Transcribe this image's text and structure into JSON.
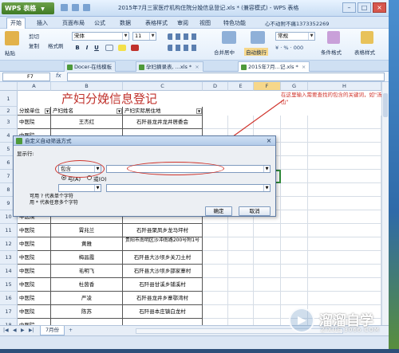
{
  "app": {
    "name": "WPS 表格",
    "title": "2015年7月三家医疗机构住院分娩信息登记.xls * (兼容模式) - WPS 表格"
  },
  "menu": {
    "tabs": [
      "开始",
      "插入",
      "页面布局",
      "公式",
      "数据",
      "表格样式",
      "审阅",
      "视图",
      "特色功能"
    ],
    "active": "开始",
    "notify": "心不动附不痛1373352269"
  },
  "ribbon": {
    "paste": "粘贴",
    "cut": "剪切",
    "copy": "复制",
    "format_painter": "格式刷",
    "font_name": "宋体",
    "font_size": "11",
    "bold": "B",
    "italic": "I",
    "underline": "U",
    "merge": "合并居中",
    "wrap": "自动换行",
    "general": "常规",
    "conditional": "条件格式",
    "table_style": "表格样式"
  },
  "doc_tabs": [
    {
      "label": "Docer-在线模板",
      "active": false
    },
    {
      "label": "孕妇摘录表, ...xls *",
      "active": false
    },
    {
      "label": "2015年7月...记.xls *",
      "active": true
    }
  ],
  "formula": {
    "cell_ref": "F7",
    "fx": "fx",
    "value": ""
  },
  "columns": [
    "A",
    "B",
    "C",
    "D",
    "E",
    "F",
    "G",
    "H"
  ],
  "selected_column": "F",
  "sheet": {
    "title": "产妇分娩信息登记",
    "headers": [
      "分娩单位",
      "产妇姓名",
      "产妇实际居住地"
    ],
    "rows": [
      {
        "num": "3",
        "unit": "中医院",
        "name": "王杰红",
        "addr": "石阡县龙井龙井居委会"
      },
      {
        "num": "4",
        "unit": "中医院",
        "name": "",
        "addr": ""
      },
      {
        "num": "5",
        "unit": "中医院",
        "name": "",
        "addr": ""
      },
      {
        "num": "6",
        "unit": "中医院",
        "name": "",
        "addr": ""
      },
      {
        "num": "7",
        "unit": "中医院",
        "name": "",
        "addr": ""
      },
      {
        "num": "8",
        "unit": "中医院",
        "name": "",
        "addr": ""
      },
      {
        "num": "9",
        "unit": "中医院",
        "name": "",
        "addr": ""
      },
      {
        "num": "10",
        "unit": "中医院",
        "name": "",
        "addr": ""
      },
      {
        "num": "11",
        "unit": "中医院",
        "name": "霄兆兰",
        "addr": "石阡县聚凤乡龙马坪村"
      },
      {
        "num": "12",
        "unit": "中医院",
        "name": "黄雅",
        "addr": "贵阳市南明区沙冲南路200号附1号"
      },
      {
        "num": "13",
        "unit": "中医院",
        "name": "梅昌霞",
        "addr": "石阡县大沙坝乡关刀土村"
      },
      {
        "num": "14",
        "unit": "中医院",
        "name": "毛明飞",
        "addr": "石阡县大沙坝乡邵家寨村"
      },
      {
        "num": "15",
        "unit": "中医院",
        "name": "杜茵香",
        "addr": "石阡县甘溪乡铺溪村"
      },
      {
        "num": "16",
        "unit": "中医院",
        "name": "严凌",
        "addr": "石阡县龙井乡寨鄂湾村"
      },
      {
        "num": "17",
        "unit": "中医院",
        "name": "陈苏",
        "addr": "石阡县本庄镇白龙村"
      },
      {
        "num": "18",
        "unit": "中医院",
        "name": "",
        "addr": ""
      }
    ]
  },
  "annotation": "在这里输入需要查找的包含的关键词，如\"汤山\"",
  "sheet_tab": "7月份",
  "dialog": {
    "title": "自定义自动筛选方式",
    "show_rows": "显示行:",
    "operator": "包含",
    "value": "",
    "and_label": "与(A)",
    "or_label": "或(O)",
    "hint_line1": "可用 ? 代表单个字符",
    "hint_line2": "用 * 代表任意多个字符",
    "ok": "确定",
    "cancel": "取消"
  },
  "watermark": {
    "brand": "溜溜自学",
    "site": "ZIXUE.3066.COM"
  },
  "colors": {
    "title_red": "#c0322c",
    "annotation_red": "#d0342c",
    "app_green": "#4e9a3a",
    "selected_col": "#f6d78a"
  }
}
